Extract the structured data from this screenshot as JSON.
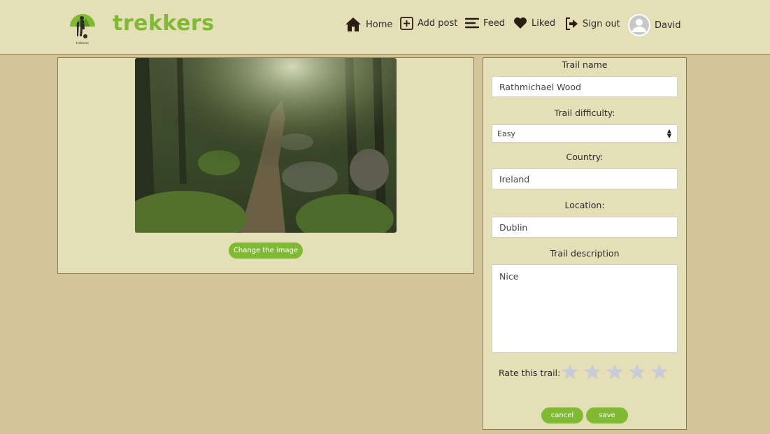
{
  "brand": {
    "name": "trekkers",
    "logo_caption": "trekkers",
    "color": "#7fba32"
  },
  "nav": {
    "items": [
      {
        "label": "Home",
        "icon": "home-icon"
      },
      {
        "label": "Add post",
        "icon": "plus-square-icon"
      },
      {
        "label": "Feed",
        "icon": "feed-lines-icon"
      },
      {
        "label": "Liked",
        "icon": "heart-icon"
      },
      {
        "label": "Sign out",
        "icon": "sign-out-icon"
      }
    ],
    "user": {
      "name": "David",
      "icon": "user-avatar-icon"
    }
  },
  "image_panel": {
    "change_button": "Change the image"
  },
  "form": {
    "trail_name_label": "Trail name",
    "trail_name_value": "Rathmichael Wood",
    "difficulty_label": "Trail difficulty:",
    "difficulty_value": "Easy",
    "country_label": "Country:",
    "country_value": "Ireland",
    "location_label": "Location:",
    "location_value": "Dublin",
    "description_label": "Trail description",
    "description_value": "Nice",
    "rate_label": "Rate this trail:",
    "rating": 0,
    "max_rating": 5,
    "cancel_label": "cancel",
    "save_label": "save"
  },
  "colors": {
    "background": "#d4c698",
    "panel": "#e5dfb8",
    "accent": "#7fba32",
    "star_empty": "#c9ccd6"
  }
}
